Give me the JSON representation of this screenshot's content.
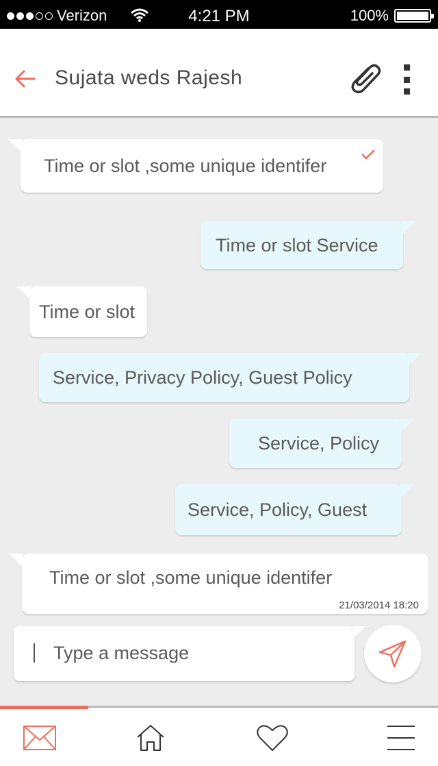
{
  "status_bar": {
    "carrier": "Verizon",
    "time": "4:21 PM",
    "battery": "100%",
    "signal_bars_filled": 3,
    "signal_bars_total": 5
  },
  "header": {
    "title": "Sujata weds Rajesh",
    "back_icon": "back-arrow-icon",
    "attach_icon": "paperclip-icon",
    "more_icon": "more-vertical-icon"
  },
  "messages": [
    {
      "direction": "incoming",
      "text": "Time or slot ,some unique identifer",
      "read": true
    },
    {
      "direction": "outgoing",
      "text": "Time or slot Service"
    },
    {
      "direction": "incoming",
      "text": "Time or slot"
    },
    {
      "direction": "outgoing",
      "text": "Service, Privacy Policy, Guest Policy"
    },
    {
      "direction": "outgoing",
      "text": "Service, Policy"
    },
    {
      "direction": "outgoing",
      "text": "Service, Policy, Guest"
    },
    {
      "direction": "incoming",
      "text": "Time or slot ,some unique identifer",
      "timestamp": "21/03/2014 18:20"
    }
  ],
  "composer": {
    "placeholder": "Type a message",
    "value": "",
    "send_icon": "send-icon"
  },
  "bottom_nav": {
    "active_index": 0,
    "items": [
      {
        "icon": "mail-icon"
      },
      {
        "icon": "home-icon"
      },
      {
        "icon": "heart-icon"
      },
      {
        "icon": "menu-icon"
      }
    ]
  },
  "colors": {
    "accent": "#f26b5b",
    "incoming_bubble": "#ffffff",
    "outgoing_bubble": "#e6f8fb",
    "chat_background": "#ededed"
  }
}
